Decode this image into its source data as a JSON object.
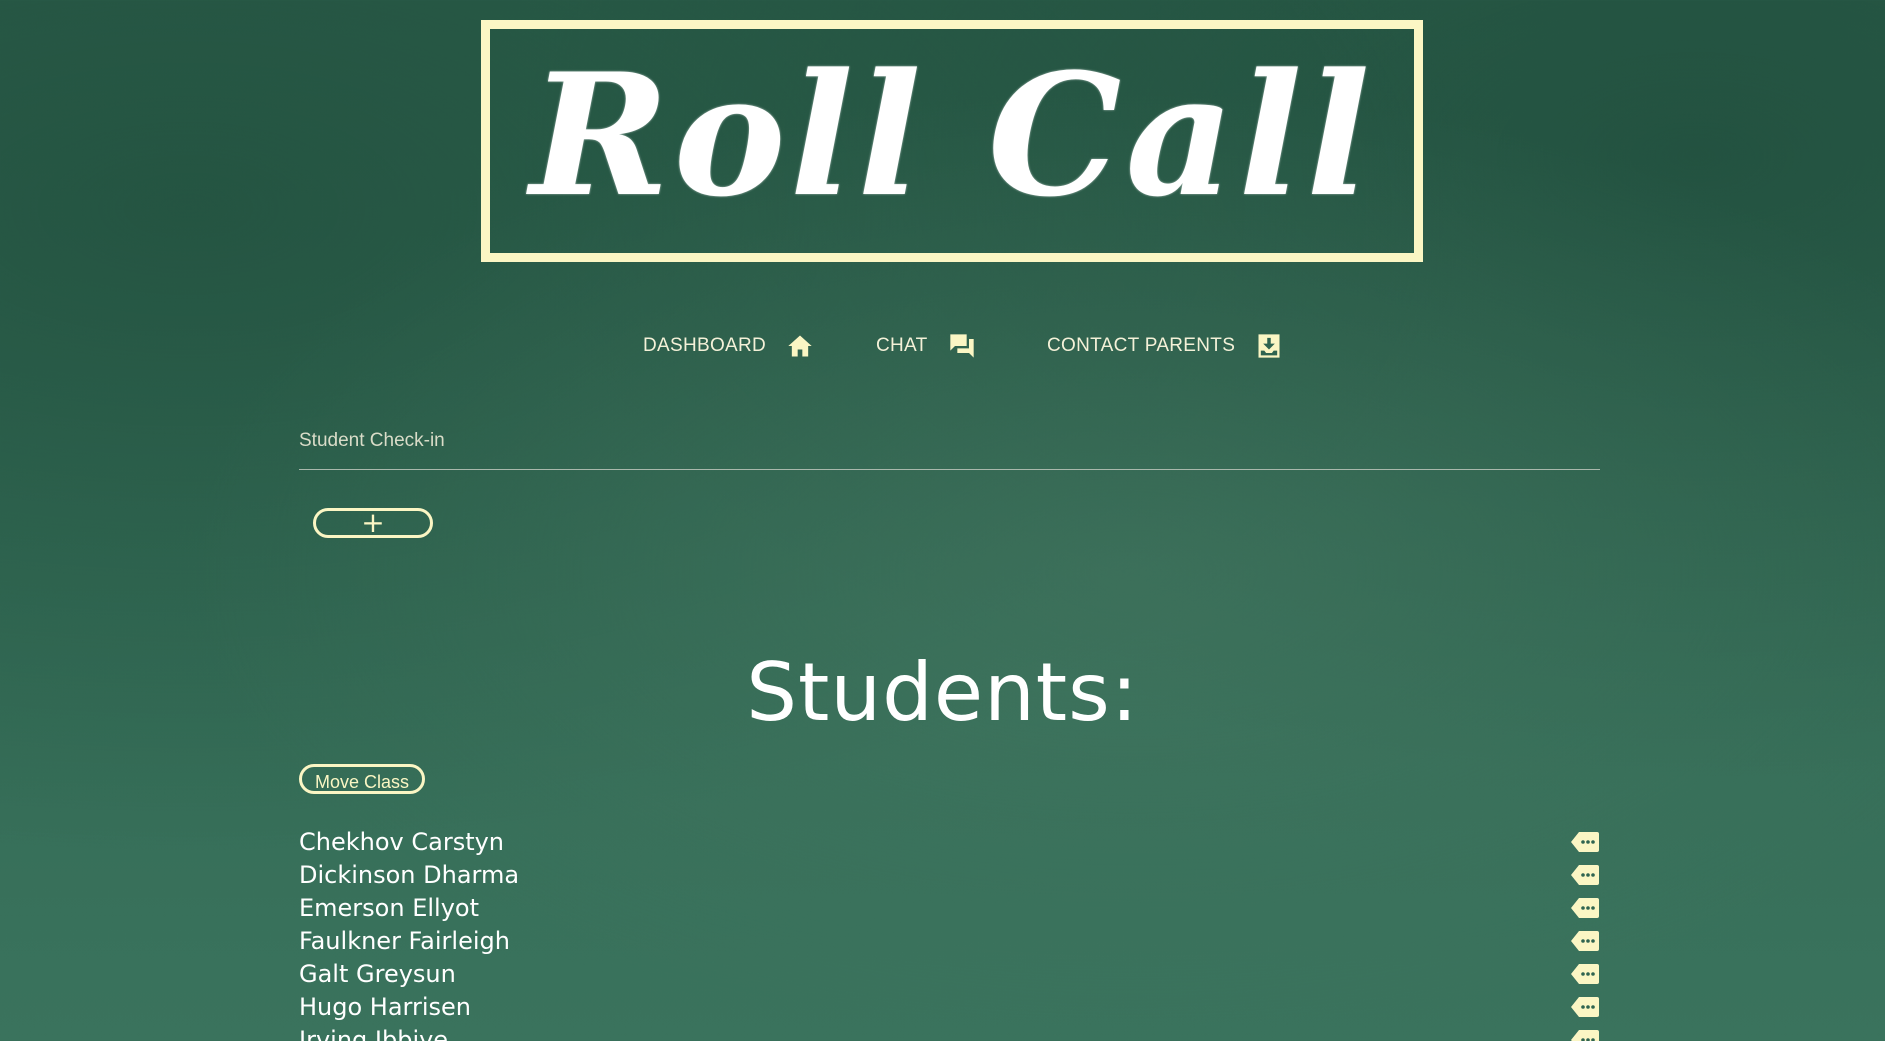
{
  "app": {
    "logo_text": "Roll Call"
  },
  "nav": {
    "items": [
      {
        "label": "DASHBOARD",
        "icon": "home-icon"
      },
      {
        "label": "CHAT",
        "icon": "chat-icon"
      },
      {
        "label": "CONTACT PARENTS",
        "icon": "inbox-download-icon"
      }
    ]
  },
  "checkin": {
    "title": "Student Check-in",
    "add_label": "+"
  },
  "students": {
    "heading": "Students:",
    "move_class_label": "Move Class",
    "list": [
      {
        "name": "Chekhov Carstyn",
        "icon": "tag-more-icon"
      },
      {
        "name": "Dickinson Dharma",
        "icon": "tag-more-icon"
      },
      {
        "name": "Emerson Ellyot",
        "icon": "tag-more-icon"
      },
      {
        "name": "Faulkner Fairleigh",
        "icon": "tag-more-icon"
      },
      {
        "name": "Galt Greysun",
        "icon": "tag-more-icon"
      },
      {
        "name": "Hugo Harrisen",
        "icon": "tag-more-icon"
      },
      {
        "name": "Irving Ibbiye",
        "icon": "tag-more-icon"
      }
    ]
  },
  "colors": {
    "background": "#2f6450",
    "accent": "#fbf6c4",
    "text": "#ffffff"
  }
}
